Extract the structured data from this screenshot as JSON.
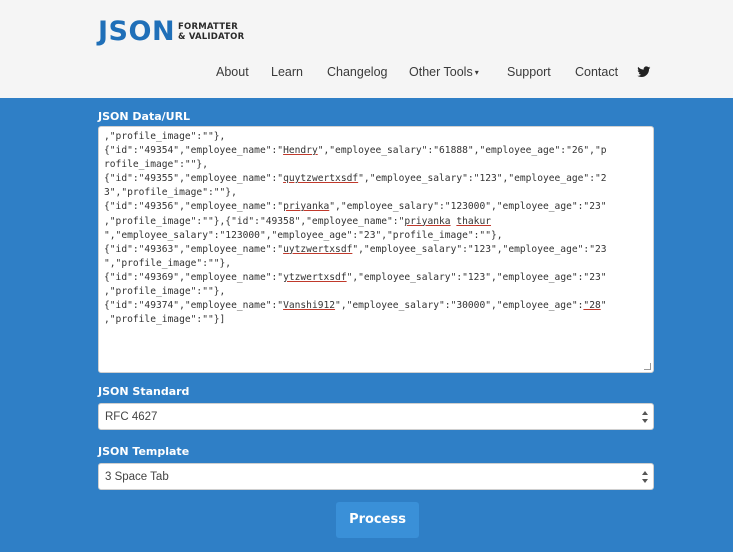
{
  "logo": {
    "main": "JSON",
    "sub_line1": "FORMATTER",
    "sub_line2": "& VALIDATOR"
  },
  "nav": {
    "items": [
      "About",
      "Learn",
      "Changelog",
      "Other Tools",
      "Support",
      "Contact"
    ],
    "dropdown_caret": "▾",
    "twitter_icon": "twitter-bird-icon"
  },
  "form": {
    "data_label": "JSON Data/URL",
    "code_lines": [
      [
        ",\"profile_image\":\"\"},"
      ],
      [
        "{\"id\":\"49354\",\"employee_name\":\"",
        {
          "u": "Hendry"
        },
        "\",\"employee_salary\":\"61888\",\"employee_age\":\"26\",\"p"
      ],
      [
        "rofile_image\":\"\"},"
      ],
      [
        "{\"id\":\"49355\",\"employee_name\":\"",
        {
          "u": "quytzwertxsdf"
        },
        "\",\"employee_salary\":\"123\",\"employee_age\":\"2"
      ],
      [
        "3\",\"profile_image\":\"\"},"
      ],
      [
        "{\"id\":\"49356\",\"employee_name\":\"",
        {
          "u": "priyanka"
        },
        "\",\"employee_salary\":\"123000\",\"employee_age\":\"23\""
      ],
      [
        ",\"profile_image\":\"\"},{\"id\":\"49358\",\"employee_name\":\"",
        {
          "u": "priyanka"
        },
        " ",
        {
          "u": "thakur"
        }
      ],
      [
        "\",\"employee_salary\":\"123000\",\"employee_age\":\"23\",\"profile_image\":\"\"},"
      ],
      [
        "{\"id\":\"49363\",\"employee_name\":\"",
        {
          "u": "uytzwertxsdf"
        },
        "\",\"employee_salary\":\"123\",\"employee_age\":\"23"
      ],
      [
        "\",\"profile_image\":\"\"},"
      ],
      [
        "{\"id\":\"49369\",\"employee_name\":\"",
        {
          "u": "ytzwertxsdf"
        },
        "\",\"employee_salary\":\"123\",\"employee_age\":\"23\""
      ],
      [
        ",\"profile_image\":\"\"},"
      ],
      [
        "{\"id\":\"49374\",\"employee_name\":\"",
        {
          "u": "Vanshi912"
        },
        "\",\"employee_salary\":\"30000\",\"employee_age\":",
        {
          "u": "\"28"
        },
        "\""
      ],
      [
        ",\"profile_image\":\"\"}]"
      ]
    ],
    "standard_label": "JSON Standard",
    "standard_value": "RFC 4627",
    "template_label": "JSON Template",
    "template_value": "3 Space Tab",
    "process_label": "Process"
  },
  "colors": {
    "brand_blue": "#1f6fb8",
    "panel_blue": "#2f7fc6",
    "button_blue": "#3a90d8",
    "header_bg": "#f5f5f5"
  }
}
